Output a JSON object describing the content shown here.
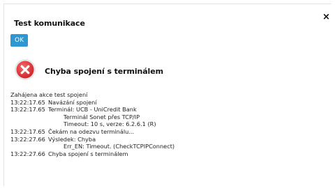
{
  "dialog": {
    "title": "Test komunikace",
    "close_label": "×",
    "ok_label": "OK"
  },
  "error": {
    "icon": "error-x-icon",
    "message": "Chyba spojení s terminálem",
    "color": "#e0282c"
  },
  "log": {
    "header": "Zahájena akce test spojení",
    "entries": [
      {
        "time": "13:22:17.65",
        "message": "Navázání spojení"
      },
      {
        "time": "13:22:17.65",
        "message": "Terminál: UCB - UniCredit Bank"
      },
      {
        "time": "",
        "message": "Terminál Sonet přes TCP/IP"
      },
      {
        "time": "",
        "message": "Timeout: 10 s, verze: 6.2.6.1 (R)"
      },
      {
        "time": "13:22:17.65",
        "message": "Čekám na odezvu terminálu..."
      },
      {
        "time": "13:22:27.66",
        "message": "Výsledek: Chyba"
      },
      {
        "time": "",
        "message": "Err_EN: Timeout. (CheckTCPIPConnect)"
      },
      {
        "time": "13:22:27.66",
        "message": "Chyba spojení s terminálem"
      }
    ]
  }
}
